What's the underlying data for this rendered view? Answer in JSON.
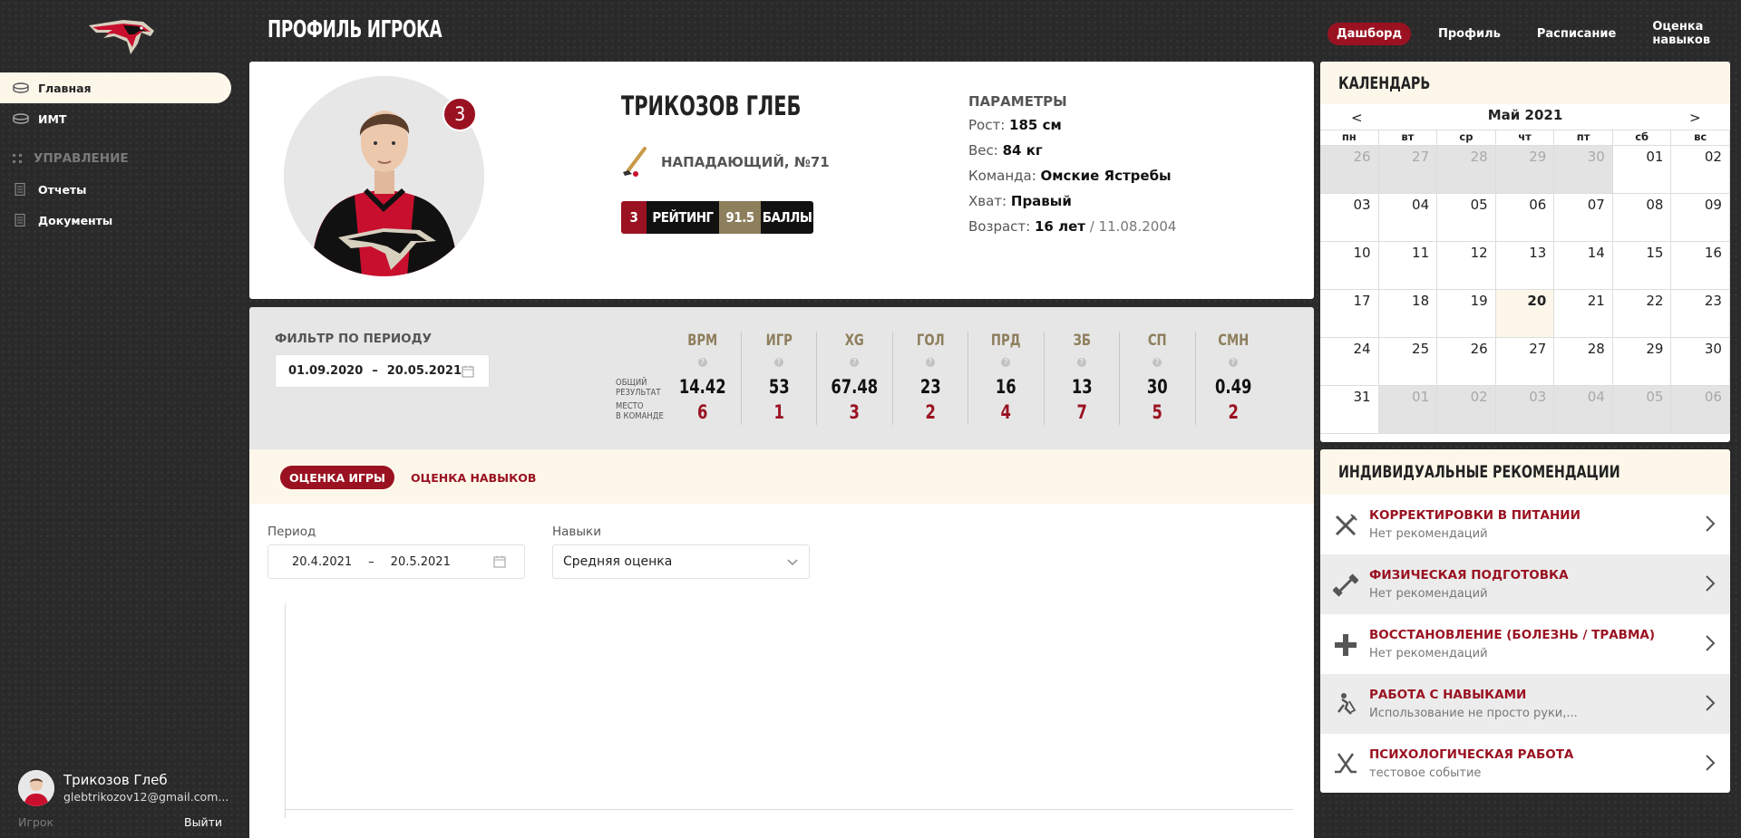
{
  "sidebar": {
    "nav": [
      {
        "label": "Главная",
        "icon": "puck-icon",
        "active": true
      },
      {
        "label": "ИМТ",
        "icon": "puck-icon",
        "active": false
      }
    ],
    "section_label": "УПРАВЛЕНИЕ",
    "section_items": [
      {
        "label": "Отчеты",
        "icon": "document-icon"
      },
      {
        "label": "Документы",
        "icon": "document-icon"
      }
    ],
    "user": {
      "name": "Трикозов Глеб",
      "email": "glebtrikozov12@gmail.com...",
      "role": "Игрок",
      "logout": "Выйти"
    }
  },
  "header": {
    "title": "ПРОФИЛЬ ИГРОКА",
    "nav": [
      "Дашборд",
      "Профиль",
      "Расписание",
      "Оценка навыков"
    ],
    "active_nav": "Дашборд"
  },
  "profile": {
    "rank_badge": "3",
    "name": "ТРИКОЗОВ ГЛЕБ",
    "position": "НАПАДАЮЩИЙ, №71",
    "rating_place": "3",
    "rating_label": "РЕЙТИНГ",
    "score": "91.5",
    "score_label": "БАЛЛЫ",
    "params_title": "ПАРАМЕТРЫ",
    "params": {
      "height_label": "Рост:",
      "height": "185 см",
      "weight_label": "Вес:",
      "weight": "84 кг",
      "team_label": "Команда:",
      "team": "Омские Ястребы",
      "grip_label": "Хват:",
      "grip": "Правый",
      "age_label": "Возраст:",
      "age": "16 лет",
      "birth": " / 11.08.2004"
    }
  },
  "filter": {
    "title": "ФИЛЬТР ПО ПЕРИОДУ",
    "from": "01.09.2020",
    "to": "20.05.2021",
    "sep": "–"
  },
  "stats": {
    "total_label_1": "ОБЩИЙ",
    "total_label_2": "РЕЗУЛЬТАТ",
    "place_label_1": "МЕСТО",
    "place_label_2": "В КОМАНДЕ",
    "columns": [
      {
        "key": "ВРМ",
        "value": "14.42",
        "place": "6"
      },
      {
        "key": "ИГР",
        "value": "53",
        "place": "1"
      },
      {
        "key": "XG",
        "value": "67.48",
        "place": "3"
      },
      {
        "key": "ГОЛ",
        "value": "23",
        "place": "2"
      },
      {
        "key": "ПРД",
        "value": "16",
        "place": "4"
      },
      {
        "key": "ЗБ",
        "value": "13",
        "place": "7"
      },
      {
        "key": "СП",
        "value": "30",
        "place": "5"
      },
      {
        "key": "СМН",
        "value": "0.49",
        "place": "2"
      }
    ]
  },
  "tabs": {
    "game": "ОЦЕНКА ИГРЫ",
    "skills": "ОЦЕНКА НАВЫКОВ",
    "active": "ОЦЕНКА ИГРЫ"
  },
  "chart_controls": {
    "period_label": "Период",
    "period_from": "20.4.2021",
    "period_to": "20.5.2021",
    "sep": "–",
    "skills_label": "Навыки",
    "skills_value": "Средняя оценка"
  },
  "calendar": {
    "title": "КАЛЕНДАРЬ",
    "month": "Май 2021",
    "prev": "<",
    "next": ">",
    "weekdays": [
      "пн",
      "вт",
      "ср",
      "чт",
      "пт",
      "сб",
      "вс"
    ],
    "days": [
      {
        "d": "26",
        "m": true
      },
      {
        "d": "27",
        "m": true
      },
      {
        "d": "28",
        "m": true
      },
      {
        "d": "29",
        "m": true
      },
      {
        "d": "30",
        "m": true
      },
      {
        "d": "01"
      },
      {
        "d": "02"
      },
      {
        "d": "03"
      },
      {
        "d": "04"
      },
      {
        "d": "05"
      },
      {
        "d": "06"
      },
      {
        "d": "07"
      },
      {
        "d": "08"
      },
      {
        "d": "09"
      },
      {
        "d": "10"
      },
      {
        "d": "11"
      },
      {
        "d": "12"
      },
      {
        "d": "13"
      },
      {
        "d": "14"
      },
      {
        "d": "15"
      },
      {
        "d": "16"
      },
      {
        "d": "17"
      },
      {
        "d": "18"
      },
      {
        "d": "19"
      },
      {
        "d": "20",
        "t": true
      },
      {
        "d": "21"
      },
      {
        "d": "22"
      },
      {
        "d": "23"
      },
      {
        "d": "24"
      },
      {
        "d": "25"
      },
      {
        "d": "26"
      },
      {
        "d": "27"
      },
      {
        "d": "28"
      },
      {
        "d": "29"
      },
      {
        "d": "30"
      },
      {
        "d": "31"
      },
      {
        "d": "01",
        "m": true
      },
      {
        "d": "02",
        "m": true
      },
      {
        "d": "03",
        "m": true
      },
      {
        "d": "04",
        "m": true
      },
      {
        "d": "05",
        "m": true
      },
      {
        "d": "06",
        "m": true
      }
    ]
  },
  "recommendations": {
    "title": "ИНДИВИДУАЛЬНЫЕ РЕКОМЕНДАЦИИ",
    "items": [
      {
        "title": "КОРРЕКТИРОВКИ В ПИТАНИИ",
        "sub": "Нет рекомендаций",
        "icon": "fork-knife-icon"
      },
      {
        "title": "ФИЗИЧЕСКАЯ ПОДГОТОВКА",
        "sub": "Нет рекомендаций",
        "icon": "dumbbell-icon"
      },
      {
        "title": "ВОССТАНОВЛЕНИЕ (БОЛЕЗНЬ / ТРАВМА)",
        "sub": "Нет рекомендаций",
        "icon": "plus-icon"
      },
      {
        "title": "РАБОТА С НАВЫКАМИ",
        "sub": "Использование не просто руки,...",
        "icon": "hockey-player-icon"
      },
      {
        "title": "ПСИХОЛОГИЧЕСКАЯ РАБОТА",
        "sub": "тестовое событие",
        "icon": "hockey-sticks-icon"
      }
    ]
  },
  "colors": {
    "accent": "#9a1221",
    "gold": "#8d7e5c",
    "cream": "#fdf7ea",
    "background": "#2a2a2a"
  }
}
